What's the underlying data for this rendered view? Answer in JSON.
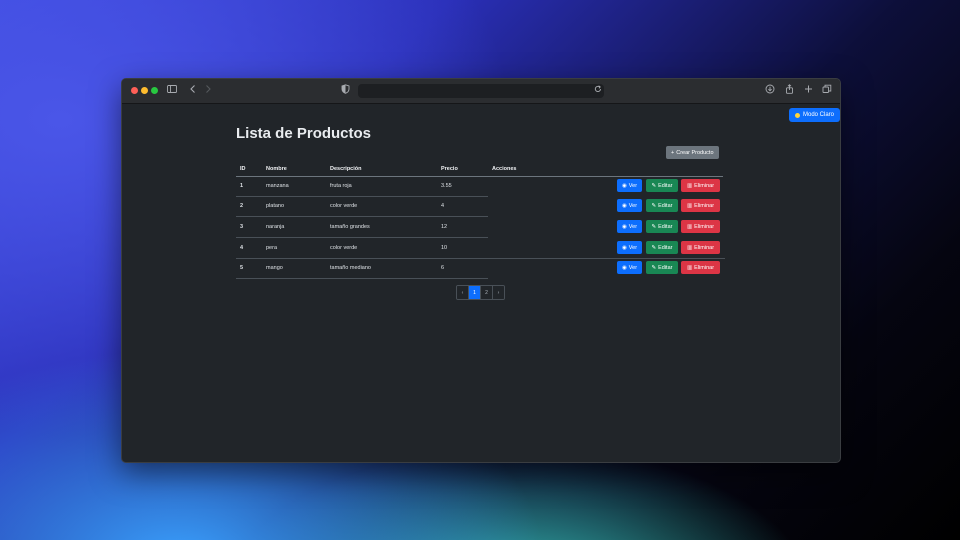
{
  "app": {
    "mode_toggle_label": "Modo Claro"
  },
  "page": {
    "title": "Lista de Productos",
    "create_label": "Crear Producto"
  },
  "table": {
    "headers": [
      "ID",
      "Nombre",
      "Descripción",
      "Precio",
      "Acciones"
    ],
    "rows": [
      {
        "id": "1",
        "nombre": "manzana",
        "descripcion": "fruta roja",
        "precio": "3.55"
      },
      {
        "id": "2",
        "nombre": "platano",
        "descripcion": "color verde",
        "precio": "4"
      },
      {
        "id": "3",
        "nombre": "naranja",
        "descripcion": "tamaño grandes",
        "precio": "12"
      },
      {
        "id": "4",
        "nombre": "pera",
        "descripcion": "color verde",
        "precio": "10"
      },
      {
        "id": "5",
        "nombre": "mango",
        "descripcion": "tamaño mediano",
        "precio": "6"
      }
    ],
    "actions": {
      "view": "Ver",
      "edit": "Editar",
      "delete": "Eliminar"
    }
  },
  "pagination": {
    "prev": "‹",
    "current": "1",
    "next_page": "2",
    "next": "›"
  },
  "colors": {
    "primary": "#0d6efd",
    "success": "#198754",
    "danger": "#dc3545",
    "secondary": "#6c757d",
    "background": "#212529"
  }
}
